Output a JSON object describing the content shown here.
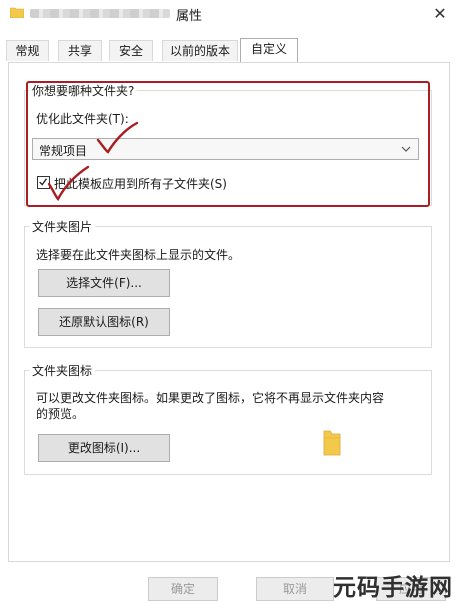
{
  "window": {
    "title": "属性",
    "close_glyph": "✕"
  },
  "tabs": [
    {
      "label": "常规",
      "active": false
    },
    {
      "label": "共享",
      "active": false
    },
    {
      "label": "安全",
      "active": false
    },
    {
      "label": "以前的版本",
      "active": false
    },
    {
      "label": "自定义",
      "active": true
    }
  ],
  "folder_type": {
    "title": "你想要哪种文件夹?",
    "optimize_label": "优化此文件夹(T):",
    "selected_value": "常规项目",
    "apply_checked": true,
    "apply_label": "把此模板应用到所有子文件夹(S)"
  },
  "folder_picture": {
    "title": "文件夹图片",
    "description": "选择要在此文件夹图标上显示的文件。",
    "choose_file_label": "选择文件(F)...",
    "restore_default_label": "还原默认图标(R)"
  },
  "folder_icon": {
    "title": "文件夹图标",
    "description_line1": "可以更改文件夹图标。如果更改了图标，它将不再显示文件夹内容",
    "description_line2": "的预览。",
    "change_icon_label": "更改图标(I)..."
  },
  "footer": {
    "ok_label": "确定",
    "cancel_label": "取消",
    "apply_label": "应用"
  },
  "watermark": "元码手游网",
  "colors": {
    "annotation_red": "#a81e22",
    "folder_yellow": "#f3c94b"
  },
  "icons": {
    "title": "folder-icon",
    "preview": "folder-icon",
    "dropdown": "chevron-down-icon",
    "check": "checkmark-icon"
  }
}
